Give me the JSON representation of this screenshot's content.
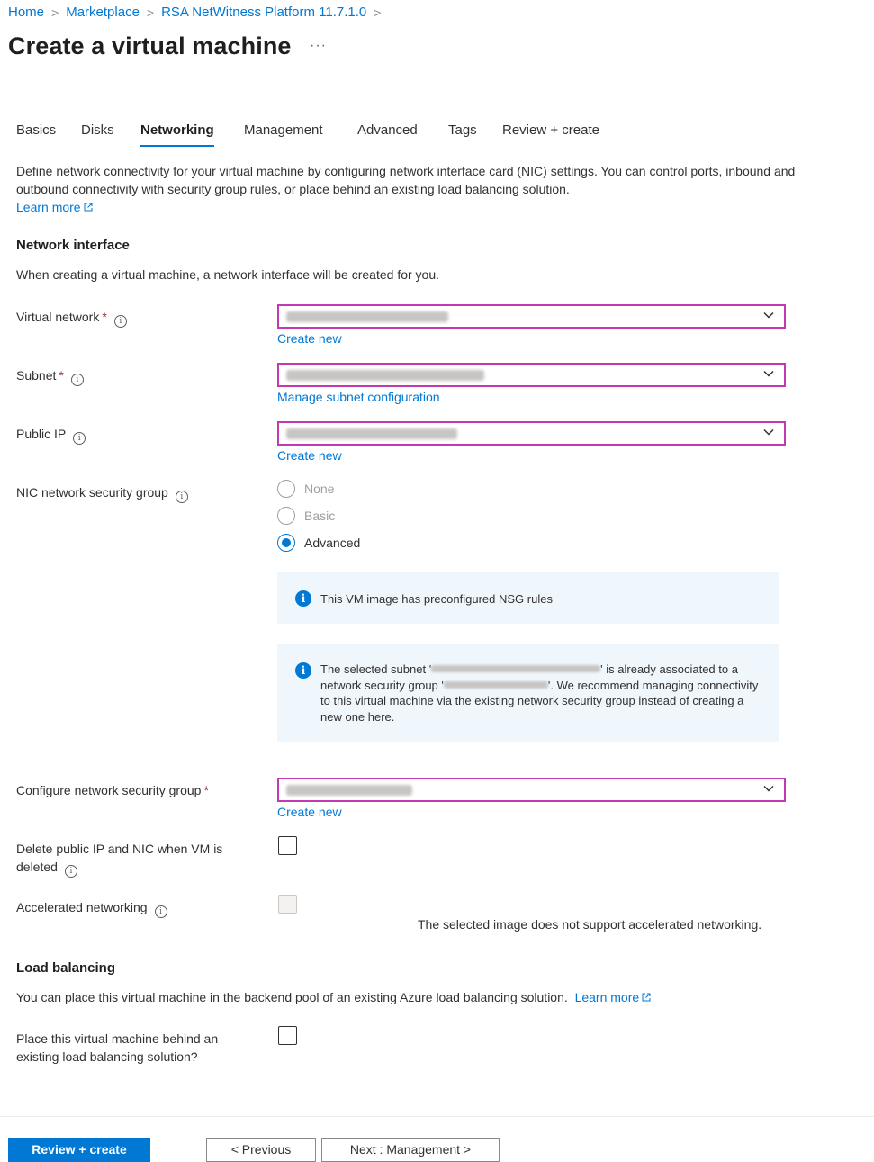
{
  "breadcrumb": {
    "items": [
      "Home",
      "Marketplace",
      "RSA NetWitness Platform 11.7.1.0"
    ],
    "separator": ">"
  },
  "page": {
    "title": "Create a virtual machine",
    "more": "···"
  },
  "tabs": [
    "Basics",
    "Disks",
    "Networking",
    "Management",
    "Advanced",
    "Tags",
    "Review + create"
  ],
  "active_tab": "Networking",
  "intro": {
    "text": "Define network connectivity for your virtual machine by configuring network interface card (NIC) settings. You can control ports, inbound and outbound connectivity with security group rules, or place behind an existing load balancing solution.",
    "learn_more": "Learn more"
  },
  "network_interface": {
    "title": "Network interface",
    "subtitle": "When creating a virtual machine, a network interface will be created for you.",
    "virtual_network": {
      "label": "Virtual network",
      "required": "*",
      "action": "Create new"
    },
    "subnet": {
      "label": "Subnet",
      "required": "*",
      "action": "Manage subnet configuration"
    },
    "public_ip": {
      "label": "Public IP",
      "action": "Create new"
    },
    "nic_nsg": {
      "label": "NIC network security group",
      "options": [
        "None",
        "Basic",
        "Advanced"
      ],
      "selected": "Advanced"
    },
    "info1": "This VM image has preconfigured NSG rules",
    "info2": {
      "p1": "The selected subnet '",
      "p2": "' is already associated to a network security group '",
      "p3": "'. We recommend managing connectivity to this virtual machine via the existing network security group instead of creating a new one here."
    },
    "configure_nsg": {
      "label": "Configure network security group",
      "required": "*",
      "action": "Create new"
    },
    "delete_public_ip": {
      "label_line1": "Delete public IP and NIC when VM is",
      "label_line2": "deleted",
      "checked": false
    },
    "accelerated": {
      "label": "Accelerated networking",
      "checked": false,
      "note": "The selected image does not support accelerated networking."
    }
  },
  "load_balancing": {
    "title": "Load balancing",
    "text": "You can place this virtual machine in the backend pool of an existing Azure load balancing solution.",
    "learn_more": "Learn more",
    "place_label_line1": "Place this virtual machine behind an",
    "place_label_line2": "existing load balancing solution?",
    "checked": false
  },
  "footer": {
    "review_create": "Review + create",
    "previous": "< Previous",
    "next": "Next : Management >"
  },
  "colors": {
    "accent": "#0078d4",
    "focus_border": "#c239b3",
    "required": "#a4262c",
    "info_bg": "#eff6fc"
  }
}
